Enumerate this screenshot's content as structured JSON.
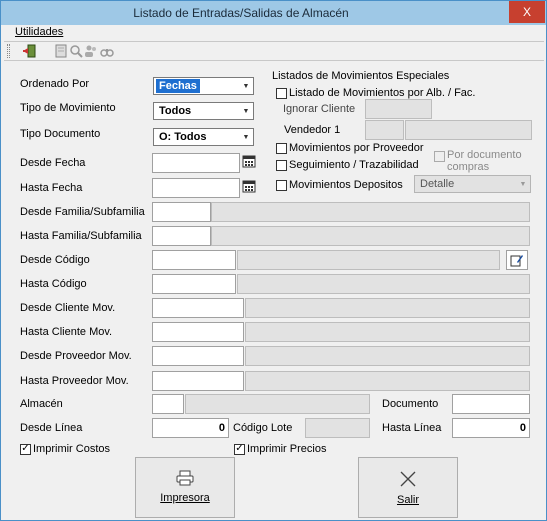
{
  "window": {
    "title": "Listado de Entradas/Salidas de Almacén",
    "close_glyph": "X"
  },
  "menu": {
    "utilidades": "Utilidades"
  },
  "toolbar": {
    "icons": [
      "exit-icon",
      "print-preview-icon",
      "search-icon",
      "users-icon",
      "binoculars-icon"
    ]
  },
  "form": {
    "ordenado_por": {
      "label": "Ordenado Por",
      "value": "Fechas"
    },
    "tipo_movimiento": {
      "label": "Tipo de Movimiento",
      "value": "Todos"
    },
    "tipo_documento": {
      "label": "Tipo Documento",
      "value": "O: Todos"
    },
    "desde_fecha": {
      "label": "Desde Fecha",
      "value": ""
    },
    "hasta_fecha": {
      "label": "Hasta Fecha",
      "value": ""
    },
    "desde_familia": {
      "label": "Desde Familia/Subfamilia",
      "value": ""
    },
    "hasta_familia": {
      "label": "Hasta Familia/Subfamilia",
      "value": ""
    },
    "desde_codigo": {
      "label": "Desde Código",
      "value": ""
    },
    "hasta_codigo": {
      "label": "Hasta Código",
      "value": ""
    },
    "desde_cliente": {
      "label": "Desde Cliente Mov.",
      "value": ""
    },
    "hasta_cliente": {
      "label": "Hasta Cliente Mov.",
      "value": ""
    },
    "desde_proveedor": {
      "label": "Desde Proveedor Mov.",
      "value": ""
    },
    "hasta_proveedor": {
      "label": "Hasta Proveedor Mov.",
      "value": ""
    },
    "almacen": {
      "label": "Almacén",
      "value": ""
    },
    "documento": {
      "label": "Documento",
      "value": ""
    },
    "desde_linea": {
      "label": "Desde Línea",
      "value": "0"
    },
    "codigo_lote": {
      "label": "Código Lote",
      "value": ""
    },
    "hasta_linea": {
      "label": "Hasta Línea",
      "value": "0"
    },
    "imprimir_costos": {
      "label": "Imprimir Costos",
      "checked": true
    },
    "imprimir_precios": {
      "label": "Imprimir Precios",
      "checked": true
    }
  },
  "especiales": {
    "title": "Listados de Movimientos Especiales",
    "por_alb_fac": {
      "label": "Listado de Movimientos por Alb. / Fac.",
      "checked": false
    },
    "ignorar_cliente": "Ignorar Cliente",
    "vendedor": "Vendedor 1",
    "por_proveedor": {
      "label": "Movimientos por Proveedor",
      "checked": false
    },
    "seguimiento": {
      "label": "Seguimiento / Trazabilidad",
      "checked": false
    },
    "por_documento_line1": "Por documento",
    "por_documento_line2": "compras",
    "depositos": {
      "label": "Movimientos Depositos",
      "checked": false
    },
    "detalle": "Detalle"
  },
  "buttons": {
    "impresora": "Impresora",
    "salir": "Salir"
  }
}
